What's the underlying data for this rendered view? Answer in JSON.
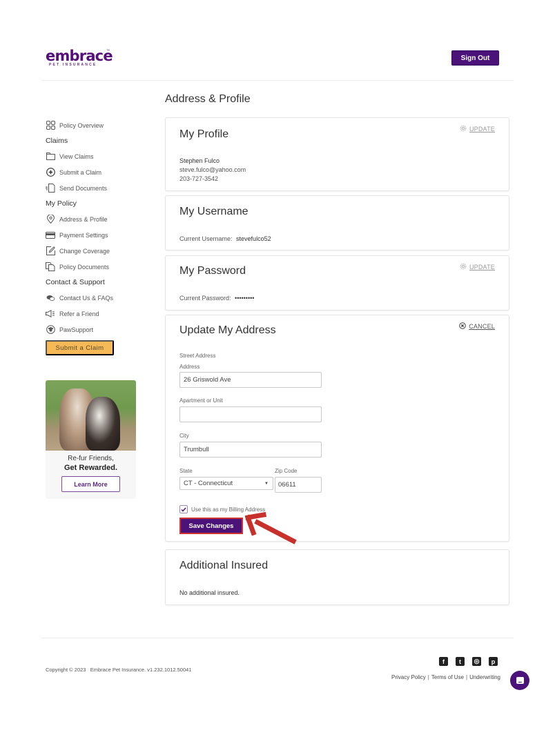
{
  "brand": {
    "name": "embrace",
    "tagline": "PET INSURANCE",
    "trademark": "™",
    "primary_color": "#4b137a",
    "accent_color": "#f6b958"
  },
  "header": {
    "sign_out_label": "Sign Out"
  },
  "sidebar": {
    "overview": {
      "label": "Policy Overview",
      "icon": "grid-icon"
    },
    "sections": [
      {
        "heading": "Claims",
        "items": [
          {
            "label": "View Claims",
            "icon": "folder-icon"
          },
          {
            "label": "Submit a Claim",
            "icon": "plus-circle-icon"
          },
          {
            "label": "Send Documents",
            "icon": "document-send-icon"
          }
        ]
      },
      {
        "heading": "My Policy",
        "items": [
          {
            "label": "Address & Profile",
            "icon": "location-pin-icon"
          },
          {
            "label": "Payment Settings",
            "icon": "credit-card-icon"
          },
          {
            "label": "Change Coverage",
            "icon": "edit-icon"
          },
          {
            "label": "Policy Documents",
            "icon": "documents-icon"
          }
        ]
      },
      {
        "heading": "Contact & Support",
        "items": [
          {
            "label": "Contact Us & FAQs",
            "icon": "chat-bubbles-icon"
          },
          {
            "label": "Refer a Friend",
            "icon": "megaphone-icon"
          },
          {
            "label": "PawSupport",
            "icon": "paw-icon"
          }
        ]
      }
    ],
    "submit_claim_button": "Submit a Claim",
    "promo": {
      "line1": "Re-fur Friends,",
      "line2": "Get Rewarded.",
      "button": "Learn More"
    }
  },
  "main": {
    "page_title": "Address & Profile",
    "profile": {
      "title": "My Profile",
      "action": "UPDATE",
      "name": "Stephen Fulco",
      "email": "steve.fulco@yahoo.com",
      "phone": "203-727-3542"
    },
    "username": {
      "title": "My Username",
      "label": "Current Username:",
      "value": "stevefulco52"
    },
    "password": {
      "title": "My Password",
      "action": "UPDATE",
      "label": "Current Password:",
      "value": "•••••••••"
    },
    "address_form": {
      "title": "Update My Address",
      "action": "CANCEL",
      "section_label": "Street Address",
      "address_label": "Address",
      "address_value": "26 Griswold Ave",
      "apartment_label": "Apartment or Unit",
      "apartment_value": "",
      "city_label": "City",
      "city_value": "Trumbull",
      "state_label": "State",
      "state_value": "CT - Connecticut",
      "zip_label": "Zip Code",
      "zip_value": "06611",
      "billing_checkbox_label": "Use this as my Billing Address",
      "billing_checked": true,
      "save_button": "Save Changes"
    },
    "additional_insured": {
      "title": "Additional Insured",
      "text": "No additional insured."
    }
  },
  "footer": {
    "copyright": "Copyright © 2023   Embrace Pet Insurance. v1.232.1012.50041",
    "socials": [
      {
        "name": "facebook",
        "glyph": "f"
      },
      {
        "name": "twitter",
        "glyph": "t"
      },
      {
        "name": "instagram",
        "glyph": "◎"
      },
      {
        "name": "pinterest",
        "glyph": "p"
      }
    ],
    "links": [
      "Privacy Policy",
      "Terms of Use",
      "Underwriting"
    ]
  }
}
